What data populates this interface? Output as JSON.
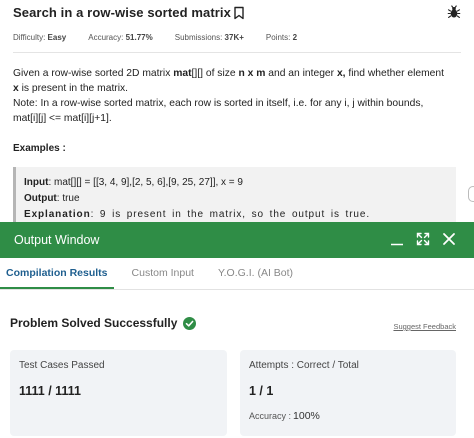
{
  "problem": {
    "title": "Search in a row-wise sorted matrix",
    "meta": {
      "difficulty_label": "Difficulty:",
      "difficulty_value": "Easy",
      "accuracy_label": "Accuracy:",
      "accuracy_value": "51.77%",
      "submissions_label": "Submissions:",
      "submissions_value": "37K+",
      "points_label": "Points:",
      "points_value": "2"
    },
    "description": {
      "l1_a": "Given a row-wise sorted 2D matrix ",
      "l1_b": "mat",
      "l1_c": "[][] of size ",
      "l1_d": "n x m",
      "l1_e": " and an integer ",
      "l1_f": "x,",
      "l1_g": " find whether element",
      "l2_a": "x",
      "l2_b": " is present in the matrix.",
      "l3": "Note: In a row-wise sorted matrix, each row is sorted in itself, i.e. for any i, j within bounds,",
      "l4": "mat[i][j] <= mat[i][j+1]."
    },
    "examples_label": "Examples :",
    "example": {
      "input_label": "Input",
      "input_value": ": mat[][] = [[3, 4, 9],[2, 5, 6],[9, 25, 27]], x = 9",
      "output_label": "Output",
      "output_value": ": true",
      "explanation_label": "Explanation",
      "explanation_value": ": 9 is present in the matrix, so the output is true."
    }
  },
  "output_window": {
    "title": "Output Window",
    "tabs": [
      {
        "label": "Compilation Results",
        "active": true
      },
      {
        "label": "Custom Input",
        "active": false
      },
      {
        "label": "Y.O.G.I. (AI Bot)",
        "active": false
      }
    ],
    "status": "Problem Solved Successfully",
    "feedback_link": "Suggest Feedback",
    "test_cases": {
      "label": "Test Cases Passed",
      "value": "1111 / 1111"
    },
    "attempts": {
      "label": "Attempts : Correct / Total",
      "value": "1 / 1",
      "accuracy_label": "Accuracy :",
      "accuracy_value": "100%"
    }
  },
  "colors": {
    "brand_green": "#2f8d46",
    "active_tab_text": "#1f5f8f",
    "card_bg": "#f1f3f6"
  },
  "icons": [
    "bookmark-icon",
    "bug-icon",
    "minimize-icon",
    "expand-icon",
    "close-icon",
    "check-circle-icon"
  ]
}
